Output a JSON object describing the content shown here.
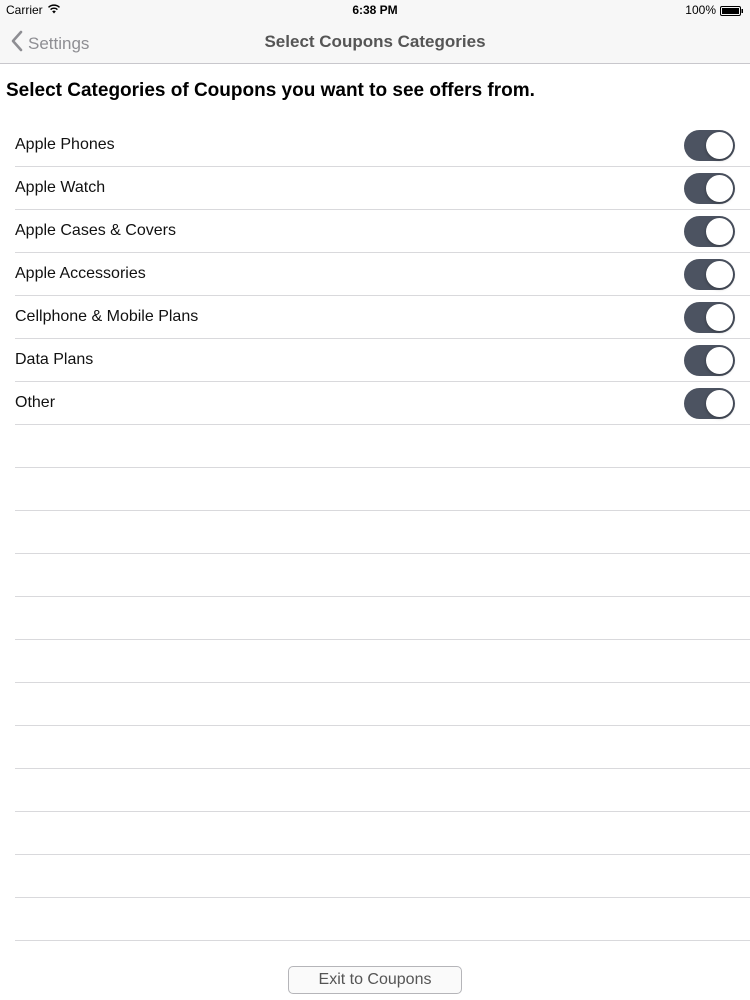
{
  "status_bar": {
    "carrier": "Carrier",
    "time": "6:38 PM",
    "battery": "100%",
    "wifi_icon": "wifi-icon",
    "battery_icon": "battery-icon"
  },
  "nav": {
    "back_label": "Settings",
    "back_icon": "chevron-left-icon",
    "title": "Select Coupons Categories"
  },
  "instruction": "Select Categories of Coupons you want to see offers from.",
  "categories": [
    {
      "label": "Apple Phones",
      "enabled": true
    },
    {
      "label": "Apple Watch",
      "enabled": true
    },
    {
      "label": "Apple Cases & Covers",
      "enabled": true
    },
    {
      "label": "Apple Accessories",
      "enabled": true
    },
    {
      "label": "Cellphone & Mobile Plans",
      "enabled": true
    },
    {
      "label": "Data Plans",
      "enabled": true
    },
    {
      "label": "Other",
      "enabled": true
    }
  ],
  "footer": {
    "exit_label": "Exit to Coupons"
  },
  "colors": {
    "toggle_on": "#4c5361",
    "separator": "#d9d9dc",
    "nav_text": "#8e8e93"
  }
}
